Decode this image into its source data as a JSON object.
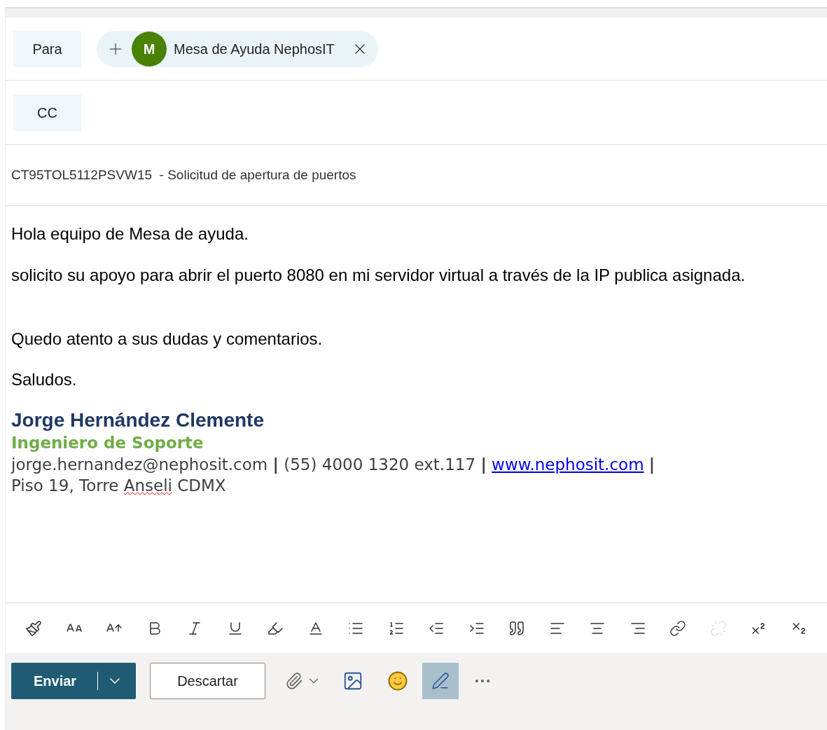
{
  "to": {
    "label": "Para",
    "recipients": [
      {
        "initial": "M",
        "name": "Mesa de Ayuda NephosIT",
        "color": "#498205"
      }
    ]
  },
  "cc": {
    "label": "CC"
  },
  "subject": {
    "value": "CT95TOL5112PSVW15  - Solicitud de apertura de puertos"
  },
  "body": {
    "paragraphs": [
      "Hola equipo de Mesa de ayuda.",
      "solicito su apoyo para abrir el puerto 8080 en mi servidor virtual a través de la IP publica asignada.",
      "Quedo atento a sus dudas y comentarios.",
      "Saludos."
    ]
  },
  "signature": {
    "name": "Jorge Hernández Clemente",
    "title": "Ingeniero de Soporte",
    "contact": [
      {
        "kind": "text",
        "text": "jorge.hernandez@nephosit.com"
      },
      {
        "kind": "sep",
        "text": "|"
      },
      {
        "kind": "text",
        "text": "(55) 4000 1320 ext.117"
      },
      {
        "kind": "sep",
        "text": "|"
      },
      {
        "kind": "link",
        "text": "www.nephosit.com"
      },
      {
        "kind": "sep",
        "text": "|"
      }
    ],
    "address": [
      {
        "text": "Piso 19, Torre ",
        "misspelled": false
      },
      {
        "text": "Anseli",
        "misspelled": true
      },
      {
        "text": " CDMX",
        "misspelled": false
      }
    ]
  },
  "format_toolbar": [
    {
      "kind": "painter",
      "disabled": false
    },
    {
      "kind": "font-size",
      "disabled": false
    },
    {
      "kind": "grow",
      "disabled": false
    },
    {
      "kind": "bold",
      "disabled": false
    },
    {
      "kind": "italic",
      "disabled": false
    },
    {
      "kind": "underline",
      "disabled": false
    },
    {
      "kind": "highlight",
      "disabled": false
    },
    {
      "kind": "font-color",
      "disabled": false
    },
    {
      "kind": "bullets",
      "disabled": false
    },
    {
      "kind": "numbering",
      "disabled": false
    },
    {
      "kind": "outdent",
      "disabled": false
    },
    {
      "kind": "indent",
      "disabled": false
    },
    {
      "kind": "quote",
      "disabled": false
    },
    {
      "kind": "align-left",
      "disabled": false
    },
    {
      "kind": "align-center",
      "disabled": false
    },
    {
      "kind": "align-right",
      "disabled": false
    },
    {
      "kind": "link",
      "disabled": false
    },
    {
      "kind": "unlink",
      "disabled": true
    },
    {
      "kind": "superscript",
      "disabled": false
    },
    {
      "kind": "subscript",
      "disabled": false
    }
  ],
  "actions": {
    "send": "Enviar",
    "discard": "Descartar",
    "format_active": true
  }
}
